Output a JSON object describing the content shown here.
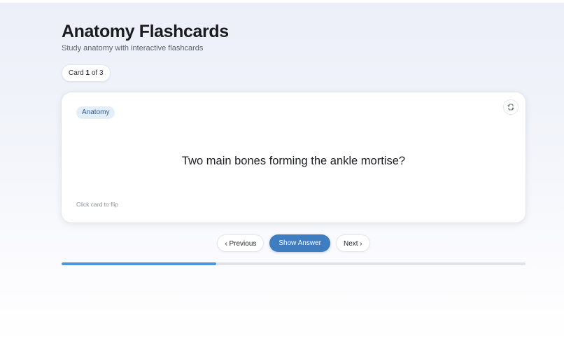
{
  "header": {
    "title": "Anatomy Flashcards",
    "subtitle": "Study anatomy with interactive flashcards"
  },
  "counter": {
    "prefix": "Card",
    "current": "1",
    "separator": "of",
    "total": "3",
    "progress_fraction": 0.3333
  },
  "card": {
    "category": "Anatomy",
    "question": "Two main bones forming the ankle mortise?",
    "hint": "Click card to flip",
    "flip_icon": "flip-icon"
  },
  "controls": {
    "previous_label": "‹ Previous",
    "show_answer_label": "Show Answer",
    "next_label": "Next ›"
  },
  "colors": {
    "accent": "#3d7dc0",
    "progress": "#4d97d9",
    "badge_bg": "#e4eef9",
    "badge_text": "#2f5c8c"
  }
}
